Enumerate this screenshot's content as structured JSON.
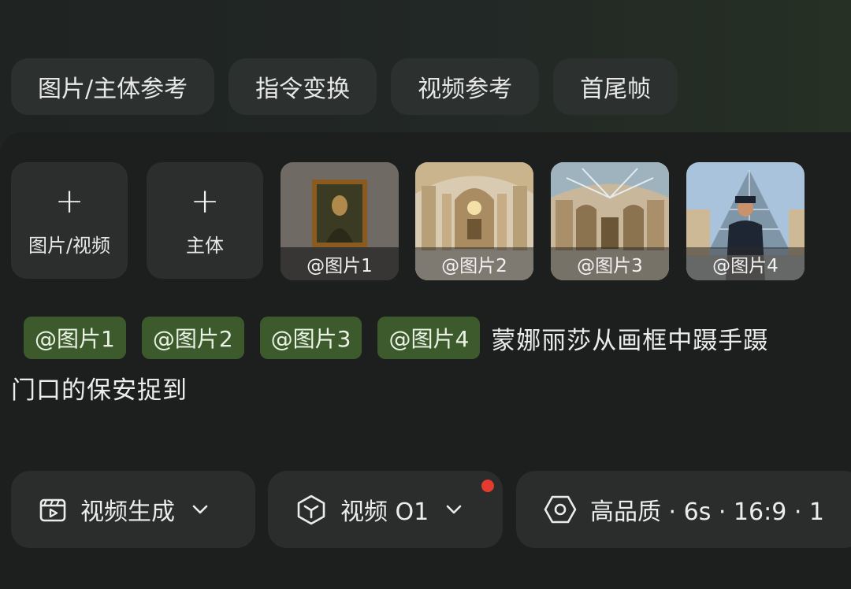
{
  "mode_tabs": [
    "图片/主体参考",
    "指令变换",
    "视频参考",
    "首尾帧"
  ],
  "uploads": {
    "image_video_label": "图片/视频",
    "subject_label": "主体",
    "plus_glyph": "+"
  },
  "references": [
    {
      "label": "@图片1",
      "scene": "mona-lisa-painting"
    },
    {
      "label": "@图片2",
      "scene": "palace-hall"
    },
    {
      "label": "@图片3",
      "scene": "glass-roof-gallery"
    },
    {
      "label": "@图片4",
      "scene": "guard-at-pyramid"
    }
  ],
  "prompt": {
    "mentions": [
      "@图片1",
      "@图片2",
      "@图片3",
      "@图片4"
    ],
    "text_line1": "蒙娜丽莎从画框中蹑手蹑",
    "text_line2": "门口的保安捉到"
  },
  "options": {
    "generation_type": "视频生成",
    "model": "视频 O1",
    "settings": "高品质 · 6s · 16:9 · 1"
  },
  "colors": {
    "mention_bg": "#3c5a2c",
    "notification_dot": "#e53b2f"
  }
}
